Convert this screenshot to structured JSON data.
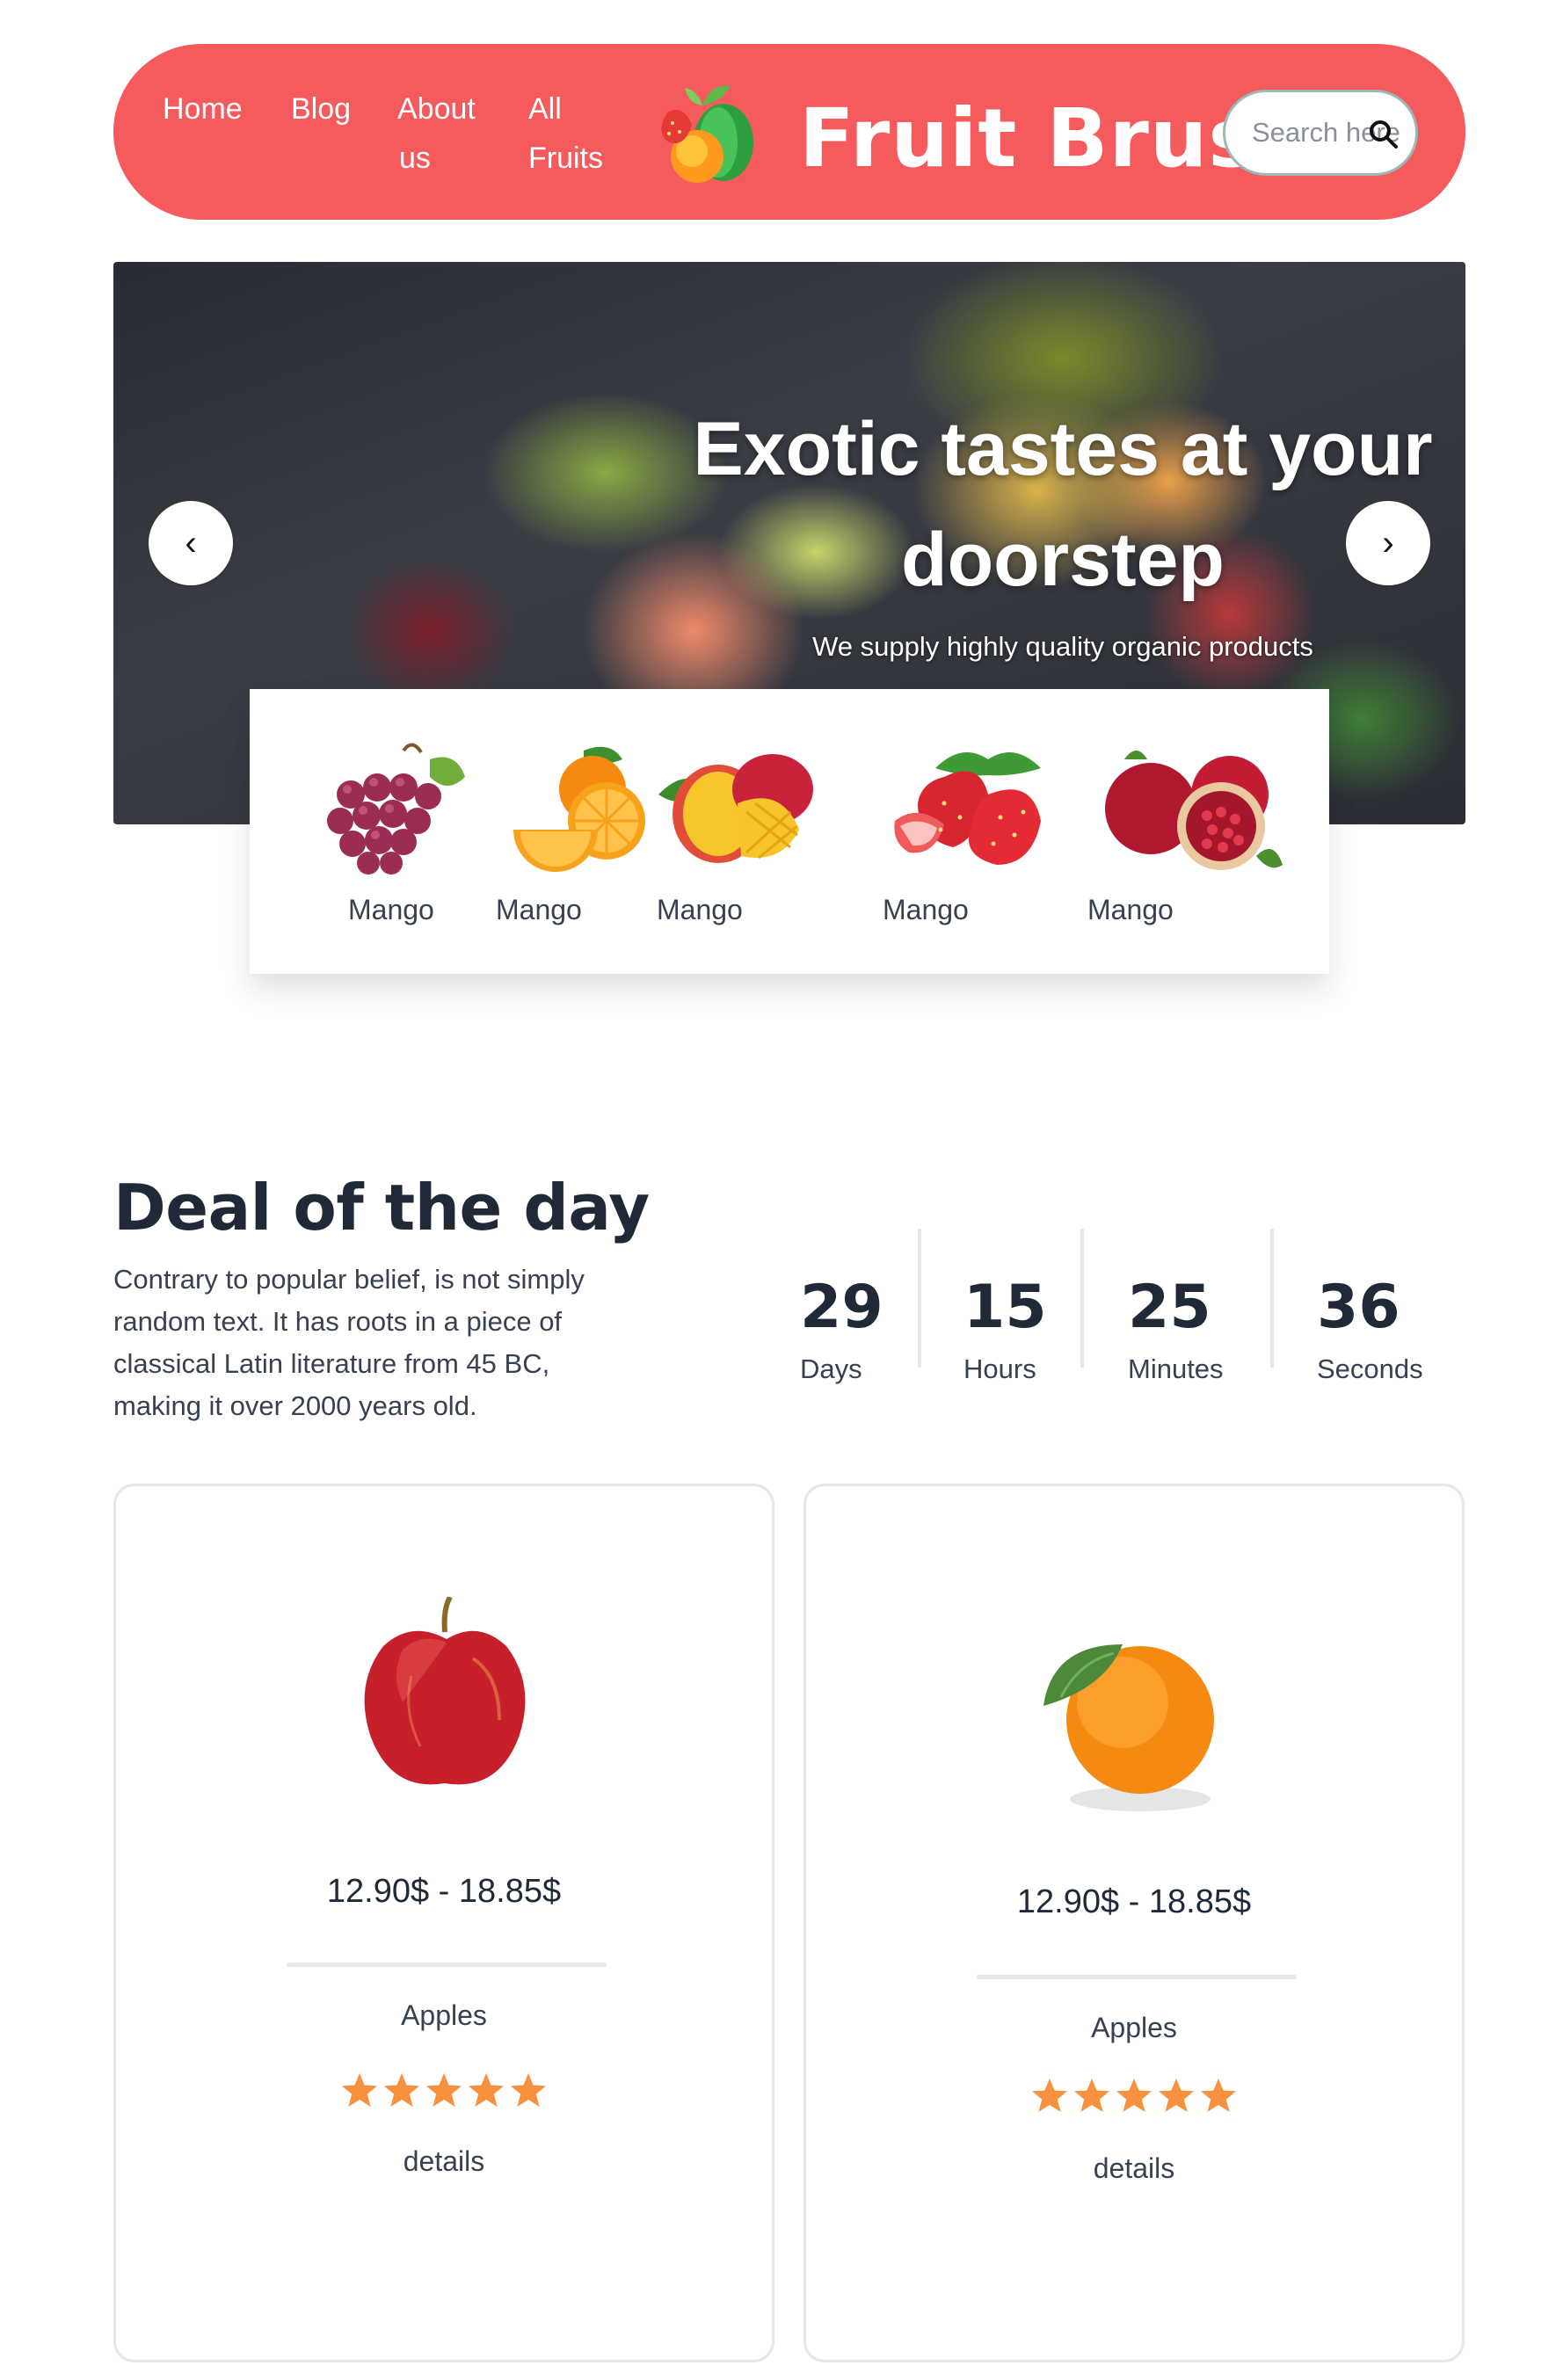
{
  "header": {
    "nav": [
      "Home",
      "Blog",
      "About us",
      "All Fruits"
    ],
    "nav_lines": {
      "about": [
        "About",
        "us"
      ],
      "all": [
        "All",
        "Fruits"
      ]
    },
    "brand": "Fruit Brust",
    "search_placeholder": "Search here"
  },
  "hero": {
    "title_line1": "Exotic tastes at your",
    "title_line2": "doorstep",
    "subtitle": "We supply highly quality organic products",
    "prev": "‹",
    "next": "›"
  },
  "categories": [
    {
      "label": "Mango",
      "icon": "grapes-icon"
    },
    {
      "label": "Mango",
      "icon": "orange-icon"
    },
    {
      "label": "Mango",
      "icon": "mango-icon"
    },
    {
      "label": "Mango",
      "icon": "strawberry-icon"
    },
    {
      "label": "Mango",
      "icon": "pomegranate-icon"
    }
  ],
  "deal": {
    "title": "Deal of the day",
    "text": "Contrary to popular belief, is not simply random text. It has roots in a piece of classical Latin literature from 45 BC, making it over 2000 years old.",
    "countdown": [
      {
        "value": "29",
        "unit": "Days"
      },
      {
        "value": "15",
        "unit": "Hours"
      },
      {
        "value": "25",
        "unit": "Minutes"
      },
      {
        "value": "36",
        "unit": "Seconds"
      }
    ]
  },
  "products": [
    {
      "price": "12.90$ - 18.85$",
      "name": "Apples",
      "rating": 5,
      "details": "details",
      "image": "apple-icon"
    },
    {
      "price": "12.90$ - 18.85$",
      "name": "Apples",
      "rating": 5,
      "details": "details",
      "image": "orange-icon"
    }
  ],
  "colors": {
    "brand": "#f55a5c",
    "star": "#f7913d",
    "text": "#1f2937"
  }
}
